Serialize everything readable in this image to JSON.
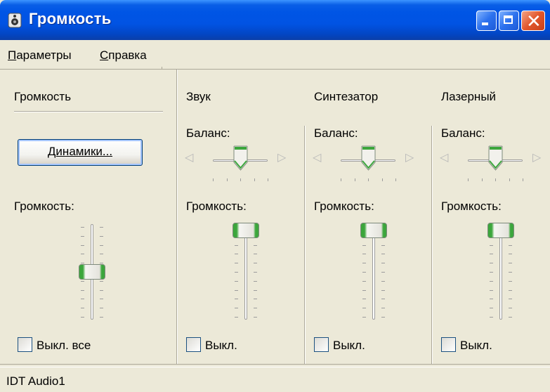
{
  "window": {
    "title": "Громкость"
  },
  "menu": {
    "items": [
      {
        "label": "Параметры",
        "accel": "П"
      },
      {
        "label": "Справка",
        "accel": "С"
      }
    ]
  },
  "master": {
    "title": "Громкость",
    "button": "Динамики...",
    "volume_label": "Громкость:",
    "volume_level": 0.5,
    "mute_label": "Выкл. все",
    "mute_checked": false
  },
  "channels": [
    {
      "title": "Звук",
      "balance_label": "Баланс:",
      "balance": 0.5,
      "volume_label": "Громкость:",
      "volume_level": 1.0,
      "mute_label": "Выкл.",
      "mute_checked": false
    },
    {
      "title": "Синтезатор",
      "balance_label": "Баланс:",
      "balance": 0.5,
      "volume_label": "Громкость:",
      "volume_level": 1.0,
      "mute_label": "Выкл.",
      "mute_checked": false
    },
    {
      "title": "Лазерный",
      "balance_label": "Баланс:",
      "balance": 0.5,
      "volume_label": "Громкость:",
      "volume_level": 1.0,
      "mute_label": "Выкл.",
      "mute_checked": false
    }
  ],
  "status": {
    "device": "IDT Audio1"
  },
  "colors": {
    "titlebar": "#0055e5",
    "face": "#ece9d8",
    "thumb_accent": "#3ca63c"
  }
}
